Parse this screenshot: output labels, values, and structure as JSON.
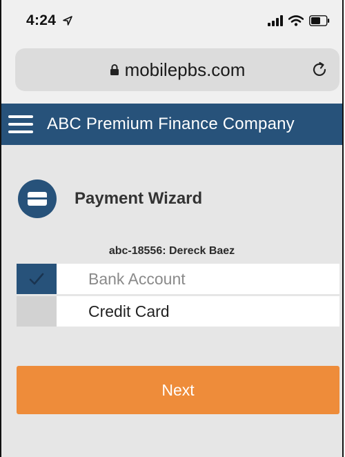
{
  "status_bar": {
    "time": "4:24",
    "icons": [
      "location-arrow-icon",
      "signal-icon",
      "wifi-icon",
      "battery-icon"
    ]
  },
  "browser": {
    "url": "mobilepbs.com",
    "icons": [
      "lock-icon",
      "reload-icon"
    ]
  },
  "header": {
    "title": "ABC Premium Finance Company",
    "menu_icon": "hamburger-icon",
    "background_color": "#27527a"
  },
  "wizard": {
    "title": "Payment Wizard",
    "icon": "credit-card-icon",
    "account_label": "abc-18556: Dereck Baez",
    "options": [
      {
        "label": "Bank Account",
        "selected": true
      },
      {
        "label": "Credit Card",
        "selected": false
      }
    ],
    "next_label": "Next",
    "next_color": "#ee8c3a"
  }
}
